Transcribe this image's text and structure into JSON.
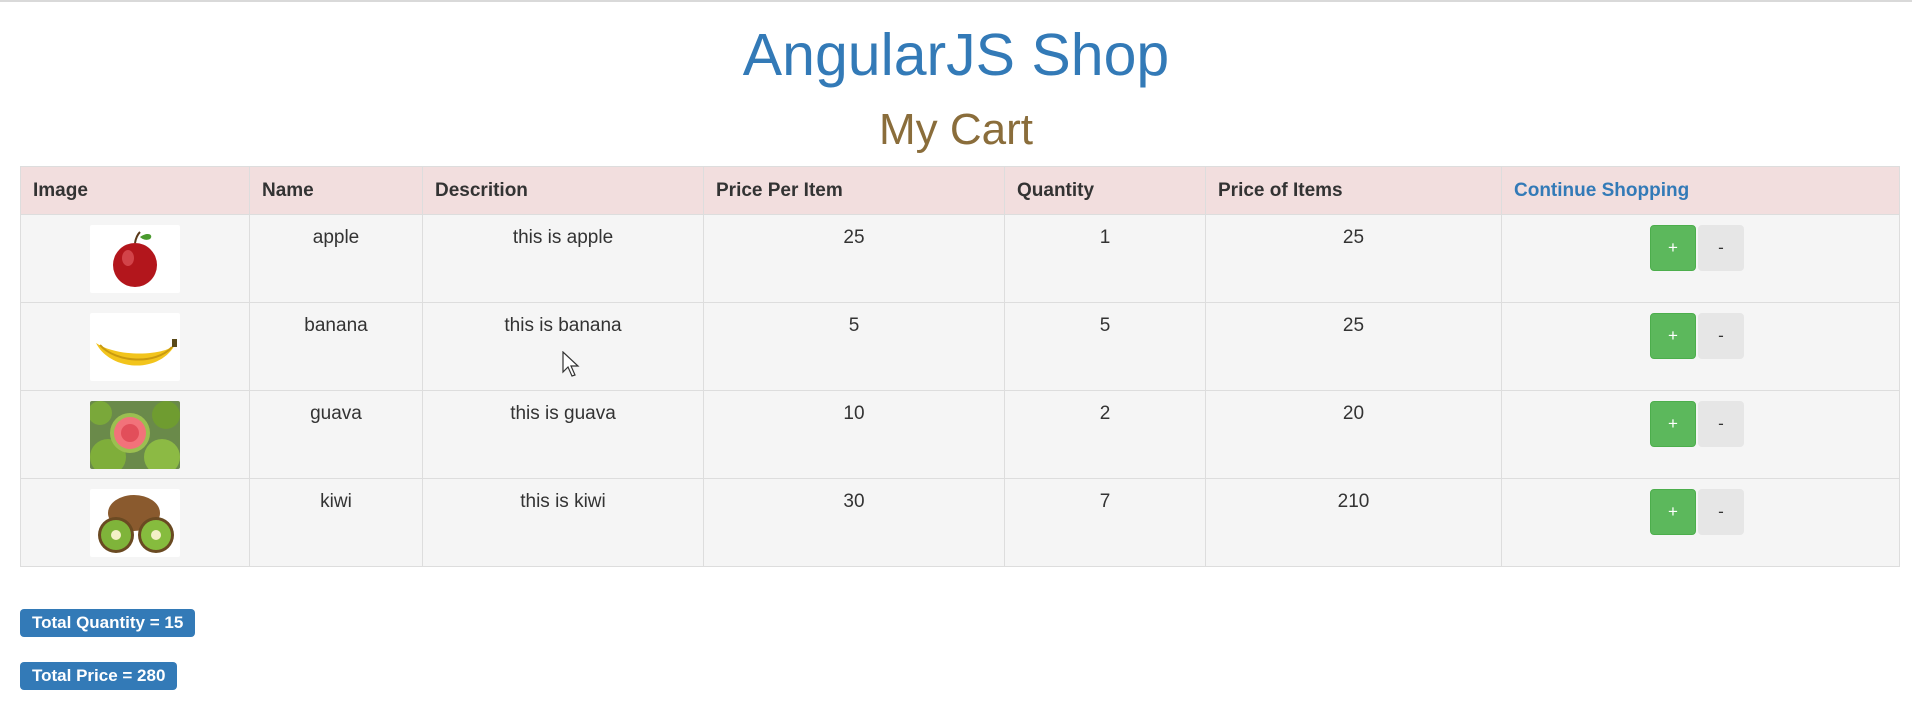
{
  "header": {
    "site_title": "AngularJS Shop",
    "page_title": "My Cart"
  },
  "table": {
    "columns": [
      "Image",
      "Name",
      "Descrition",
      "Price Per Item",
      "Quantity",
      "Price of Items"
    ],
    "continue_link": "Continue Shopping",
    "rows": [
      {
        "image_icon": "apple-image",
        "name": "apple",
        "description": "this is apple",
        "price": "25",
        "quantity": "1",
        "total": "25",
        "plus": "+",
        "minus": "-"
      },
      {
        "image_icon": "banana-image",
        "name": "banana",
        "description": "this is banana",
        "price": "5",
        "quantity": "5",
        "total": "25",
        "plus": "+",
        "minus": "-"
      },
      {
        "image_icon": "guava-image",
        "name": "guava",
        "description": "this is guava",
        "price": "10",
        "quantity": "2",
        "total": "20",
        "plus": "+",
        "minus": "-"
      },
      {
        "image_icon": "kiwi-image",
        "name": "kiwi",
        "description": "this is kiwi",
        "price": "30",
        "quantity": "7",
        "total": "210",
        "plus": "+",
        "minus": "-"
      }
    ]
  },
  "summary": {
    "total_quantity": "Total Quantity = 15",
    "total_price": "Total Price = 280"
  },
  "colors": {
    "title": "#337ab7",
    "subtitle": "#8a6d3b",
    "header_row": "#f2dede",
    "plus_button": "#5cb85c",
    "badge": "#337ab7"
  }
}
